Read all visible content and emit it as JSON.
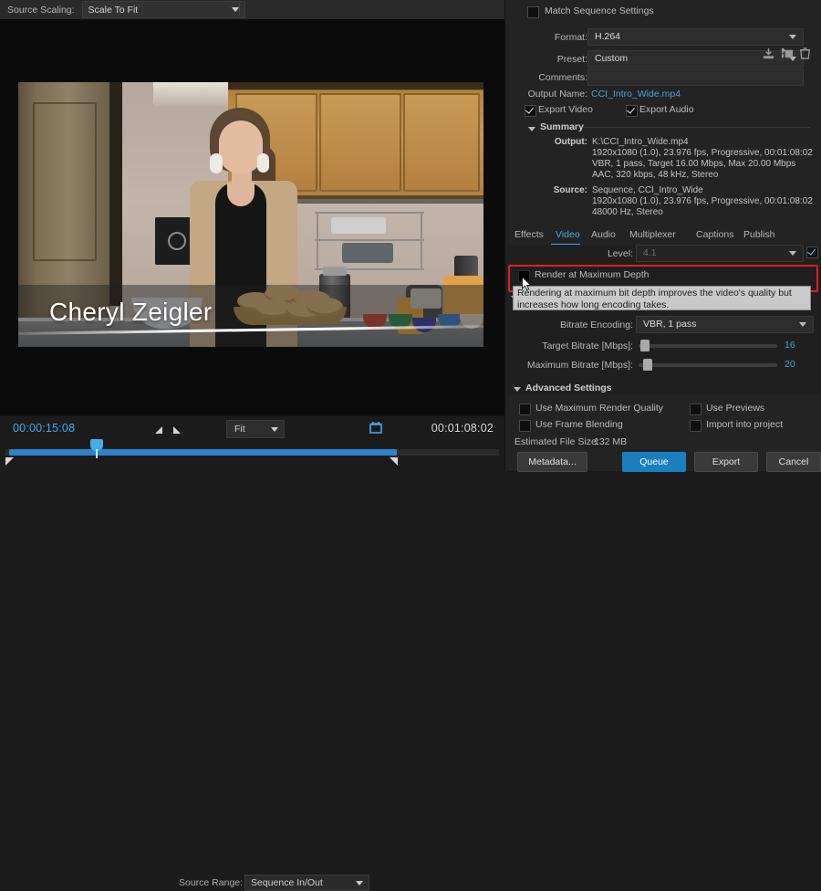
{
  "source_panel": {
    "scaling_label": "Source Scaling:",
    "scaling_value": "Scale To Fit",
    "video_title": "Cheryl Zeigler"
  },
  "transport": {
    "current_timecode": "00:00:15:08",
    "duration_timecode": "00:01:08:02",
    "zoom_level": "Fit",
    "source_range_label": "Source Range:",
    "source_range_value": "Sequence In/Out"
  },
  "export": {
    "match_sequence_label": "Match Sequence Settings",
    "format_label": "Format:",
    "format_value": "H.264",
    "preset_label": "Preset:",
    "preset_value": "Custom",
    "comments_label": "Comments:",
    "comments_value": "",
    "output_name_label": "Output Name:",
    "output_name_value": "CCI_Intro_Wide.mp4",
    "export_video_label": "Export Video",
    "export_audio_label": "Export Audio"
  },
  "summary": {
    "header": "Summary",
    "output_key": "Output:",
    "output_lines": [
      "K:\\CCI_Intro_Wide.mp4",
      "1920x1080 (1.0), 23.976 fps, Progressive, 00:01:08:02",
      "VBR, 1 pass, Target 16.00 Mbps, Max 20.00 Mbps",
      "AAC, 320 kbps, 48 kHz, Stereo"
    ],
    "source_key": "Source:",
    "source_lines": [
      "Sequence, CCI_Intro_Wide",
      "1920x1080 (1.0), 23.976 fps, Progressive, 00:01:08:02",
      "48000 Hz, Stereo"
    ]
  },
  "tabs": [
    {
      "label": "Effects",
      "active": false
    },
    {
      "label": "Video",
      "active": true
    },
    {
      "label": "Audio",
      "active": false
    },
    {
      "label": "Multiplexer",
      "active": false
    },
    {
      "label": "Captions",
      "active": false
    },
    {
      "label": "Publish",
      "active": false
    }
  ],
  "video_settings": {
    "level_label": "Level:",
    "level_value": "4.1",
    "render_max_depth_label": "Render at Maximum Depth",
    "tooltip_text": "Rendering at maximum bit depth improves the video's quality but increases how long encoding takes.",
    "bitrate_encoding_label": "Bitrate Encoding:",
    "bitrate_encoding_value": "VBR, 1 pass",
    "target_bitrate_label": "Target Bitrate [Mbps]:",
    "target_bitrate_value": "16",
    "max_bitrate_label": "Maximum Bitrate [Mbps]:",
    "max_bitrate_value": "20",
    "advanced_settings_label": "Advanced Settings"
  },
  "options": {
    "use_max_render_quality": "Use Maximum Render Quality",
    "use_previews": "Use Previews",
    "use_frame_blending": "Use Frame Blending",
    "import_into_project": "Import into project",
    "estimated_file_size_label": "Estimated File Size:",
    "estimated_file_size_value": "132 MB"
  },
  "buttons": {
    "metadata": "Metadata...",
    "queue": "Queue",
    "export": "Export",
    "cancel": "Cancel"
  },
  "colors": {
    "accent_blue": "#49a7e0",
    "highlight_red": "#e02020",
    "primary_button": "#1a7fc1"
  }
}
